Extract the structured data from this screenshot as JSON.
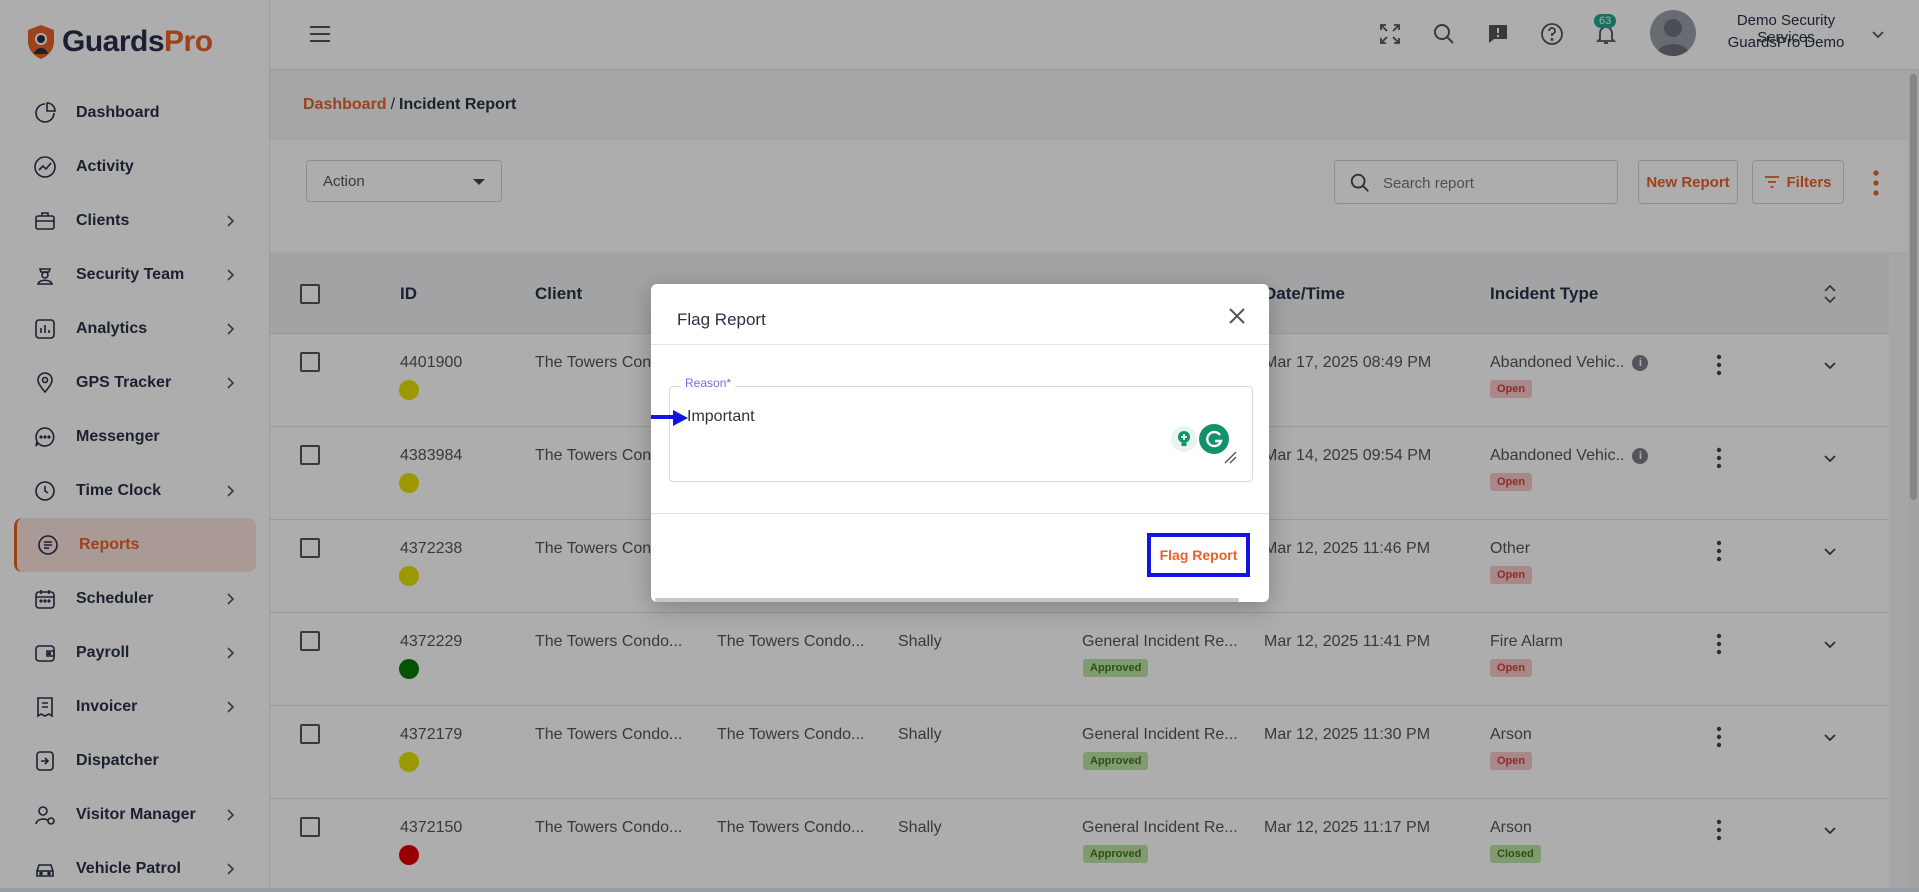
{
  "brand": {
    "name_part1": "Guards",
    "name_part2": "Pro",
    "primary_color": "#e8622a",
    "dark_color": "#2a2f4a"
  },
  "sidebar": {
    "items": [
      {
        "label": "Dashboard",
        "icon": "dashboard-icon",
        "has_chevron": false
      },
      {
        "label": "Activity",
        "icon": "activity-icon",
        "has_chevron": false
      },
      {
        "label": "Clients",
        "icon": "briefcase-icon",
        "has_chevron": true
      },
      {
        "label": "Security Team",
        "icon": "guard-icon",
        "has_chevron": true
      },
      {
        "label": "Analytics",
        "icon": "analytics-icon",
        "has_chevron": true
      },
      {
        "label": "GPS Tracker",
        "icon": "location-pin-icon",
        "has_chevron": true
      },
      {
        "label": "Messenger",
        "icon": "chat-icon",
        "has_chevron": false
      },
      {
        "label": "Time Clock",
        "icon": "clock-icon",
        "has_chevron": true
      },
      {
        "label": "Reports",
        "icon": "reports-icon",
        "has_chevron": false,
        "active": true
      },
      {
        "label": "Scheduler",
        "icon": "calendar-icon",
        "has_chevron": true
      },
      {
        "label": "Payroll",
        "icon": "wallet-icon",
        "has_chevron": true
      },
      {
        "label": "Invoicer",
        "icon": "invoice-icon",
        "has_chevron": true
      },
      {
        "label": "Dispatcher",
        "icon": "dispatch-icon",
        "has_chevron": false
      },
      {
        "label": "Visitor Manager",
        "icon": "visitor-icon",
        "has_chevron": true
      },
      {
        "label": "Vehicle Patrol",
        "icon": "car-icon",
        "has_chevron": true
      }
    ]
  },
  "topbar": {
    "notification_count": "63",
    "user_name": "Demo Security Services",
    "user_org": "GuardsPro Demo"
  },
  "breadcrumb": {
    "root": "Dashboard",
    "separator": "/",
    "current": "Incident Report"
  },
  "toolbar": {
    "action_label": "Action",
    "search_placeholder": "Search report",
    "new_report_label": "New Report",
    "filters_label": "Filters"
  },
  "table": {
    "headers": {
      "id": "ID",
      "client": "Client",
      "datetime": "Date/Time",
      "incident_type": "Incident Type"
    },
    "rows": [
      {
        "id": "4401900",
        "dot_color": "#e5e000",
        "client": "The Towers Condo...",
        "site": "",
        "guard": "",
        "report_type": "",
        "report_status": "",
        "datetime": "Mar 17, 2025 08:49 PM",
        "incident_type": "Abandoned Vehic..",
        "has_info": true,
        "status": "Open"
      },
      {
        "id": "4383984",
        "dot_color": "#e5e000",
        "client": "The Towers Condo...",
        "site": "",
        "guard": "",
        "report_type": "",
        "report_status": "",
        "datetime": "Mar 14, 2025 09:54 PM",
        "incident_type": "Abandoned Vehic..",
        "has_info": true,
        "status": "Open"
      },
      {
        "id": "4372238",
        "dot_color": "#e5e000",
        "client": "The Towers Condo...",
        "site": "",
        "guard": "",
        "report_type": "",
        "report_status": "",
        "datetime": "Mar 12, 2025 11:46 PM",
        "incident_type": "Other",
        "has_info": false,
        "status": "Open"
      },
      {
        "id": "4372229",
        "dot_color": "#0a7a0a",
        "client": "The Towers Condo...",
        "site": "The Towers Condo...",
        "guard": "Shally",
        "report_type": "General Incident Re...",
        "report_status": "Approved",
        "datetime": "Mar 12, 2025 11:41 PM",
        "incident_type": "Fire Alarm",
        "has_info": false,
        "status": "Open"
      },
      {
        "id": "4372179",
        "dot_color": "#e5e000",
        "client": "The Towers Condo...",
        "site": "The Towers Condo...",
        "guard": "Shally",
        "report_type": "General Incident Re...",
        "report_status": "Approved",
        "datetime": "Mar 12, 2025 11:30 PM",
        "incident_type": "Arson",
        "has_info": false,
        "status": "Open"
      },
      {
        "id": "4372150",
        "dot_color": "#e00000",
        "client": "The Towers Condo...",
        "site": "The Towers Condo...",
        "guard": "Shally",
        "report_type": "General Incident Re...",
        "report_status": "Approved",
        "datetime": "Mar 12, 2025 11:17 PM",
        "incident_type": "Arson",
        "has_info": false,
        "status": "Closed"
      }
    ]
  },
  "modal": {
    "title": "Flag Report",
    "reason_label": "Reason*",
    "reason_value": "Important",
    "submit_label": "Flag Report",
    "highlight_color": "#1414e0"
  }
}
